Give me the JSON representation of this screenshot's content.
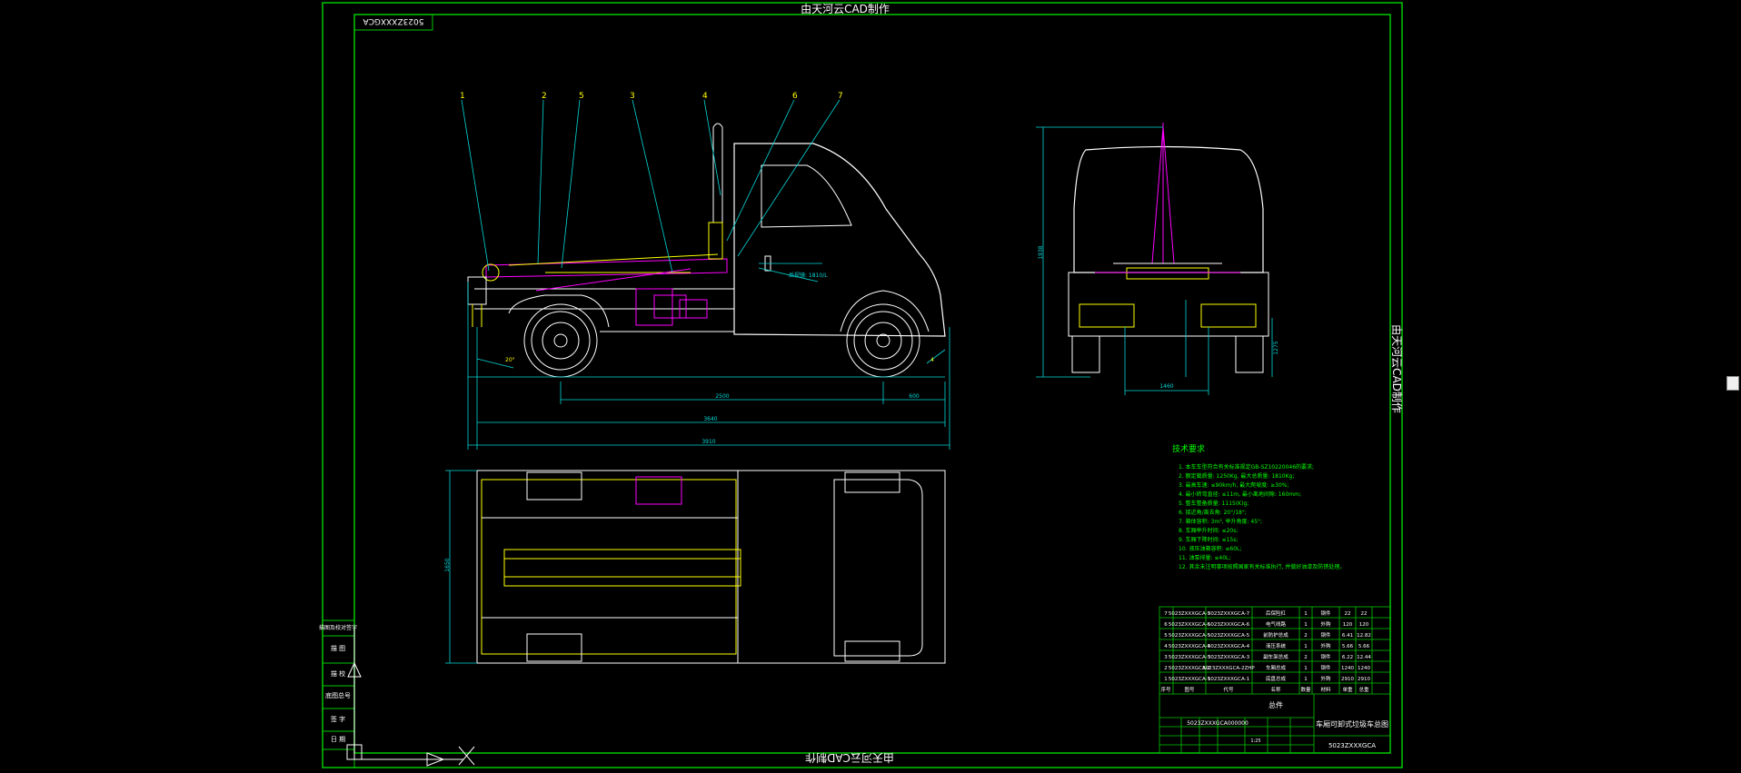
{
  "title_banner": "由天河云CAD制作",
  "side_banner": "由天河云CAD制作",
  "bottom_banner": "由天河云CAD制作",
  "drawing_code_box": "5023ZXXXGCA",
  "callouts": [
    "1",
    "2",
    "5",
    "3",
    "4",
    "6",
    "7"
  ],
  "side_dimensions": {
    "wheelbase": "2500",
    "rear_overhang": "600",
    "body_length": "3640",
    "overall_length": "3910",
    "angle_rear": "20°",
    "angle_front": "4",
    "cab_note": "后视镜: 1810/L"
  },
  "front_dimensions": {
    "height": "1938",
    "track": "1460",
    "frame": "1275"
  },
  "top_dimensions": {
    "width": "1650"
  },
  "tech_requirements": {
    "heading": "技术要求",
    "items": [
      "1. 本车车型符合有关标准规定GB-SZ10220046的要求;",
      "2. 额定载质量: 1250Kg, 最大总质量: 1810Kg;",
      "3. 最高车速: ≤90km/h, 最大爬坡度: ≥30%;",
      "4. 最小转弯直径: ≤11m, 最小离地间隙: 160mm;",
      "5. 整车整备质量: 1115(K)g;",
      "6. 接近角/离去角: 20°/18°;",
      "7. 箱体容积: 3m³, 举升角度: 45°;",
      "8. 车厢举升时间: ≤20s;",
      "9. 车厢下降时间: ≤15s;",
      "10. 液压油箱容积: ≤60L;",
      "11. 油泵排量: ≤40L;",
      "12. 其余未注明事项按照国家有关标准执行, 并做好油漆及防锈处理。"
    ]
  },
  "parts_table": {
    "rows": [
      [
        "7",
        "5023ZXXXGCA-7",
        "5023ZXXXGCA-7",
        "后保险杠",
        "1",
        "钢件",
        "22",
        "22"
      ],
      [
        "6",
        "5023ZXXXGCA-6",
        "5023ZXXXGCA-6",
        "电气线路",
        "1",
        "外购",
        "120",
        "120"
      ],
      [
        "5",
        "5023ZXXXGCA-5",
        "5023ZXXXGCA-5",
        "前防护总成",
        "2",
        "钢件",
        "6.41",
        "12.82"
      ],
      [
        "4",
        "5023ZXXXGCA-4",
        "5023ZXXXGCA-4",
        "液压系统",
        "1",
        "外购",
        "5.66",
        "5.66"
      ],
      [
        "3",
        "5023ZXXXGCA-3",
        "5023ZXXXGCA-3",
        "副车架总成",
        "2",
        "钢件",
        "6.22",
        "12.44"
      ],
      [
        "2",
        "5023ZXXXGCA-2",
        "5023ZXXXGCA-2ZHP",
        "车厢总成",
        "1",
        "钢件",
        "1240",
        "1240"
      ],
      [
        "1",
        "5023ZXXXGCA-1",
        "5023ZXXXGCA-1",
        "底盘总成",
        "1",
        "外购",
        "2910",
        "2910"
      ]
    ],
    "header": [
      "序号",
      "图号",
      "代号",
      "名称",
      "数量",
      "材料",
      "单重",
      "总重"
    ],
    "title_block": {
      "part_code": "5023ZXXXGCA000000",
      "name": "车厢可卸式垃圾车总图",
      "drawing_no": "5023ZXXXGCA",
      "label_assembly": "总件",
      "scale": "1:25"
    }
  },
  "revision_strip": [
    "描图及校对签字",
    "描 图",
    "描 校",
    "底图总号",
    "签 字",
    "日 期"
  ],
  "colors": {
    "border": "#00c800",
    "drawing": "#ffffff",
    "accent_magenta": "#ff00ff",
    "accent_yellow": "#ffff00",
    "dimension": "#00d8d8",
    "note": "#00ff00"
  }
}
